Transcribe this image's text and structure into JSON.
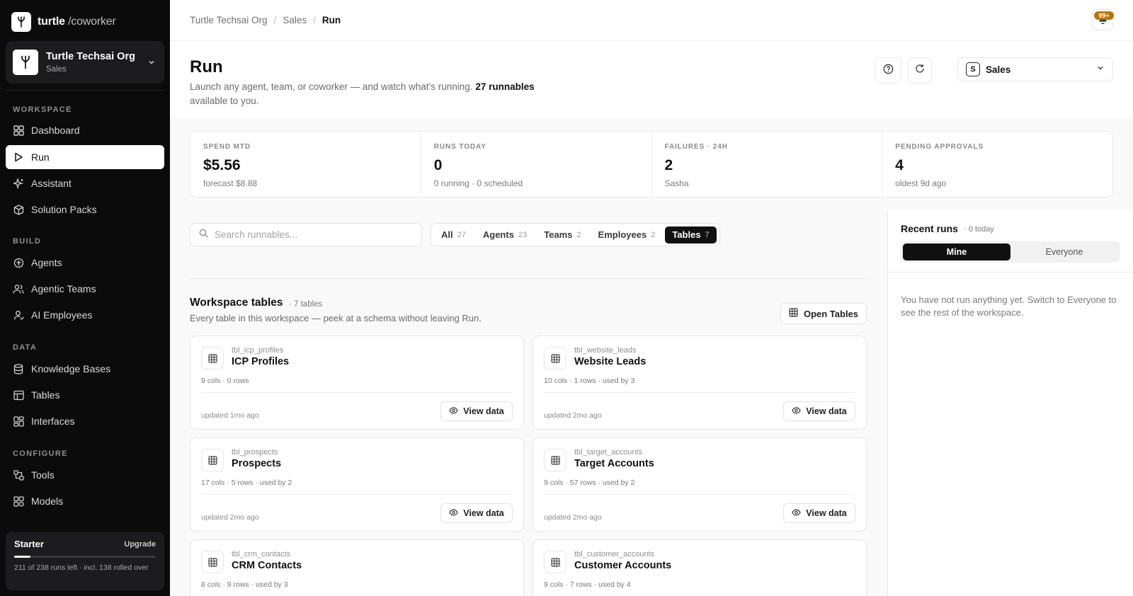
{
  "brand": {
    "name": "turtle",
    "suffix": "/coworker"
  },
  "org": {
    "name": "Turtle Techsai Org",
    "team": "Sales"
  },
  "sidebar": {
    "sections": [
      {
        "label": "WORKSPACE",
        "items": [
          {
            "label": "Dashboard",
            "icon": "dashboard-icon"
          },
          {
            "label": "Run",
            "icon": "play-icon",
            "active": true
          },
          {
            "label": "Assistant",
            "icon": "sparkle-icon"
          },
          {
            "label": "Solution Packs",
            "icon": "package-icon"
          }
        ]
      },
      {
        "label": "BUILD",
        "items": [
          {
            "label": "Agents",
            "icon": "agent-icon"
          },
          {
            "label": "Agentic Teams",
            "icon": "team-icon"
          },
          {
            "label": "AI Employees",
            "icon": "user-icon"
          }
        ]
      },
      {
        "label": "DATA",
        "items": [
          {
            "label": "Knowledge Bases",
            "icon": "database-icon"
          },
          {
            "label": "Tables",
            "icon": "table-icon"
          },
          {
            "label": "Interfaces",
            "icon": "interface-icon"
          }
        ]
      },
      {
        "label": "CONFIGURE",
        "items": [
          {
            "label": "Tools",
            "icon": "tools-icon"
          },
          {
            "label": "Models",
            "icon": "models-icon"
          }
        ]
      }
    ]
  },
  "plan": {
    "name": "Starter",
    "upgrade": "Upgrade",
    "usage_fraction": 0.113,
    "text": "211 of 238 runs left · incl. 138 rolled over"
  },
  "breadcrumb": {
    "items": [
      "Turtle Techsai Org",
      "Sales",
      "Run"
    ],
    "sep": "/"
  },
  "notifications": {
    "badge": "99+"
  },
  "page": {
    "title": "Run",
    "desc_prefix": "Launch any agent, team, or coworker — and watch what's running. ",
    "desc_bold": "27 runnables",
    "desc_suffix": " available to you."
  },
  "team_select": {
    "avatar": "S",
    "name": "Sales"
  },
  "stats": [
    {
      "label": "SPEND MTD",
      "value": "$5.56",
      "sub": "forecast $8.88"
    },
    {
      "label": "RUNS TODAY",
      "value": "0",
      "sub": "0 running · 0 scheduled"
    },
    {
      "label": "FAILURES · 24H",
      "value": "2",
      "sub": "Sasha"
    },
    {
      "label": "PENDING APPROVALS",
      "value": "4",
      "sub": "oldest 9d ago"
    }
  ],
  "search": {
    "placeholder": "Search runnables..."
  },
  "filters": [
    {
      "label": "All",
      "count": "27"
    },
    {
      "label": "Agents",
      "count": "23"
    },
    {
      "label": "Teams",
      "count": "2"
    },
    {
      "label": "Employees",
      "count": "2"
    },
    {
      "label": "Tables",
      "count": "7",
      "active": true
    }
  ],
  "section": {
    "title": "Workspace tables",
    "count": "· 7 tables",
    "desc": "Every table in this workspace — peek at a schema without leaving Run.",
    "open_label": "Open Tables"
  },
  "tables": [
    {
      "slug": "tbl_icp_profiles",
      "name": "ICP Profiles",
      "meta": "9 cols · 0 rows",
      "updated": "updated 1mo ago",
      "action": "View data"
    },
    {
      "slug": "tbl_website_leads",
      "name": "Website Leads",
      "meta": "10 cols · 1 rows  ·  used by 3",
      "updated": "updated 2mo ago",
      "action": "View data"
    },
    {
      "slug": "tbl_prospects",
      "name": "Prospects",
      "meta": "17 cols · 5 rows  ·  used by 2",
      "updated": "updated 2mo ago",
      "action": "View data"
    },
    {
      "slug": "tbl_target_accounts",
      "name": "Target Accounts",
      "meta": "9 cols · 57 rows  ·  used by 2",
      "updated": "updated 2mo ago",
      "action": "View data"
    },
    {
      "slug": "tbl_crm_contacts",
      "name": "CRM Contacts",
      "meta": "8 cols · 9 rows  ·  used by 3",
      "updated": "",
      "action": ""
    },
    {
      "slug": "tbl_customer_accounts",
      "name": "Customer Accounts",
      "meta": "9 cols · 7 rows  ·  used by 4",
      "updated": "",
      "action": ""
    }
  ],
  "recent": {
    "title": "Recent runs",
    "count": "· 0 today",
    "tabs": [
      "Mine",
      "Everyone"
    ],
    "empty": "You have not run anything yet. Switch to Everyone to see the rest of the workspace."
  }
}
